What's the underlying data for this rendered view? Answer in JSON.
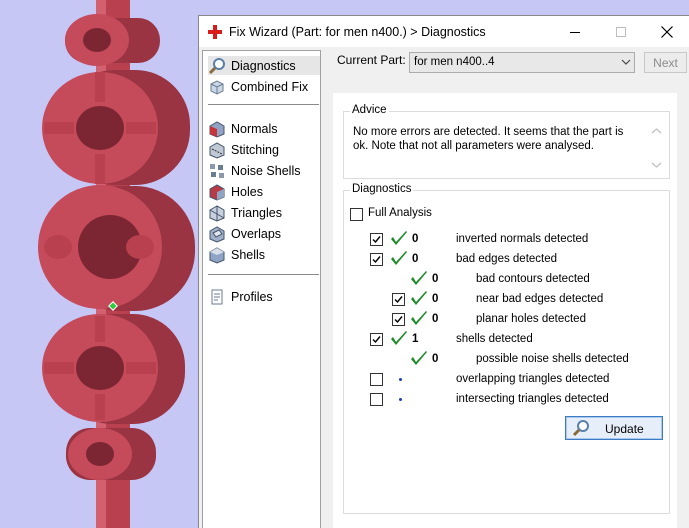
{
  "window": {
    "title": "Fix Wizard (Part: for men n400.) > Diagnostics",
    "close_glyph": "✕"
  },
  "sidebar": {
    "items": [
      {
        "label": "Diagnostics",
        "icon": "magnifier-icon",
        "selected": true
      },
      {
        "label": "Combined Fix",
        "icon": "cube-icon"
      },
      {
        "label": "Normals",
        "icon": "normals-icon"
      },
      {
        "label": "Stitching",
        "icon": "stitching-icon"
      },
      {
        "label": "Noise Shells",
        "icon": "noise-shells-icon"
      },
      {
        "label": "Holes",
        "icon": "holes-icon"
      },
      {
        "label": "Triangles",
        "icon": "triangles-icon"
      },
      {
        "label": "Overlaps",
        "icon": "overlaps-icon"
      },
      {
        "label": "Shells",
        "icon": "shells-icon"
      },
      {
        "label": "Profiles",
        "icon": "profiles-icon"
      }
    ]
  },
  "header": {
    "current_part_label": "Current Part:",
    "part_value": "for men n400..4",
    "next_label": "Next"
  },
  "advice": {
    "title": "Advice",
    "text": "No more errors are detected. It seems that the part is ok. Note that not all parameters were analysed."
  },
  "diagnostics": {
    "title": "Diagnostics",
    "full_analysis_label": "Full Analysis",
    "full_analysis_checked": false,
    "rows": [
      {
        "label": "inverted normals detected",
        "count": "0",
        "checked": true,
        "status": "ok",
        "indent": 0
      },
      {
        "label": "bad edges detected",
        "count": "0",
        "checked": true,
        "status": "ok",
        "indent": 0
      },
      {
        "label": "bad contours detected",
        "count": "0",
        "checked": null,
        "status": "ok",
        "indent": 1
      },
      {
        "label": "near bad edges detected",
        "count": "0",
        "checked": true,
        "status": "ok",
        "indent": 1
      },
      {
        "label": "planar holes detected",
        "count": "0",
        "checked": true,
        "status": "ok",
        "indent": 1
      },
      {
        "label": "shells detected",
        "count": "1",
        "checked": true,
        "status": "ok",
        "indent": 0
      },
      {
        "label": "possible noise shells detected",
        "count": "0",
        "checked": null,
        "status": "ok",
        "indent": 1
      },
      {
        "label": "overlapping triangles detected",
        "count": "",
        "checked": false,
        "status": "pending",
        "indent": 0
      },
      {
        "label": "intersecting triangles detected",
        "count": "",
        "checked": false,
        "status": "pending",
        "indent": 0
      }
    ],
    "update_label": "Update"
  },
  "colors": {
    "model": "#c54a5a",
    "model_dark": "#8e2f3b",
    "background": "#c7c7f5",
    "ok_tick": "#1e8a2a",
    "pending_dot": "#1d3fb8"
  }
}
